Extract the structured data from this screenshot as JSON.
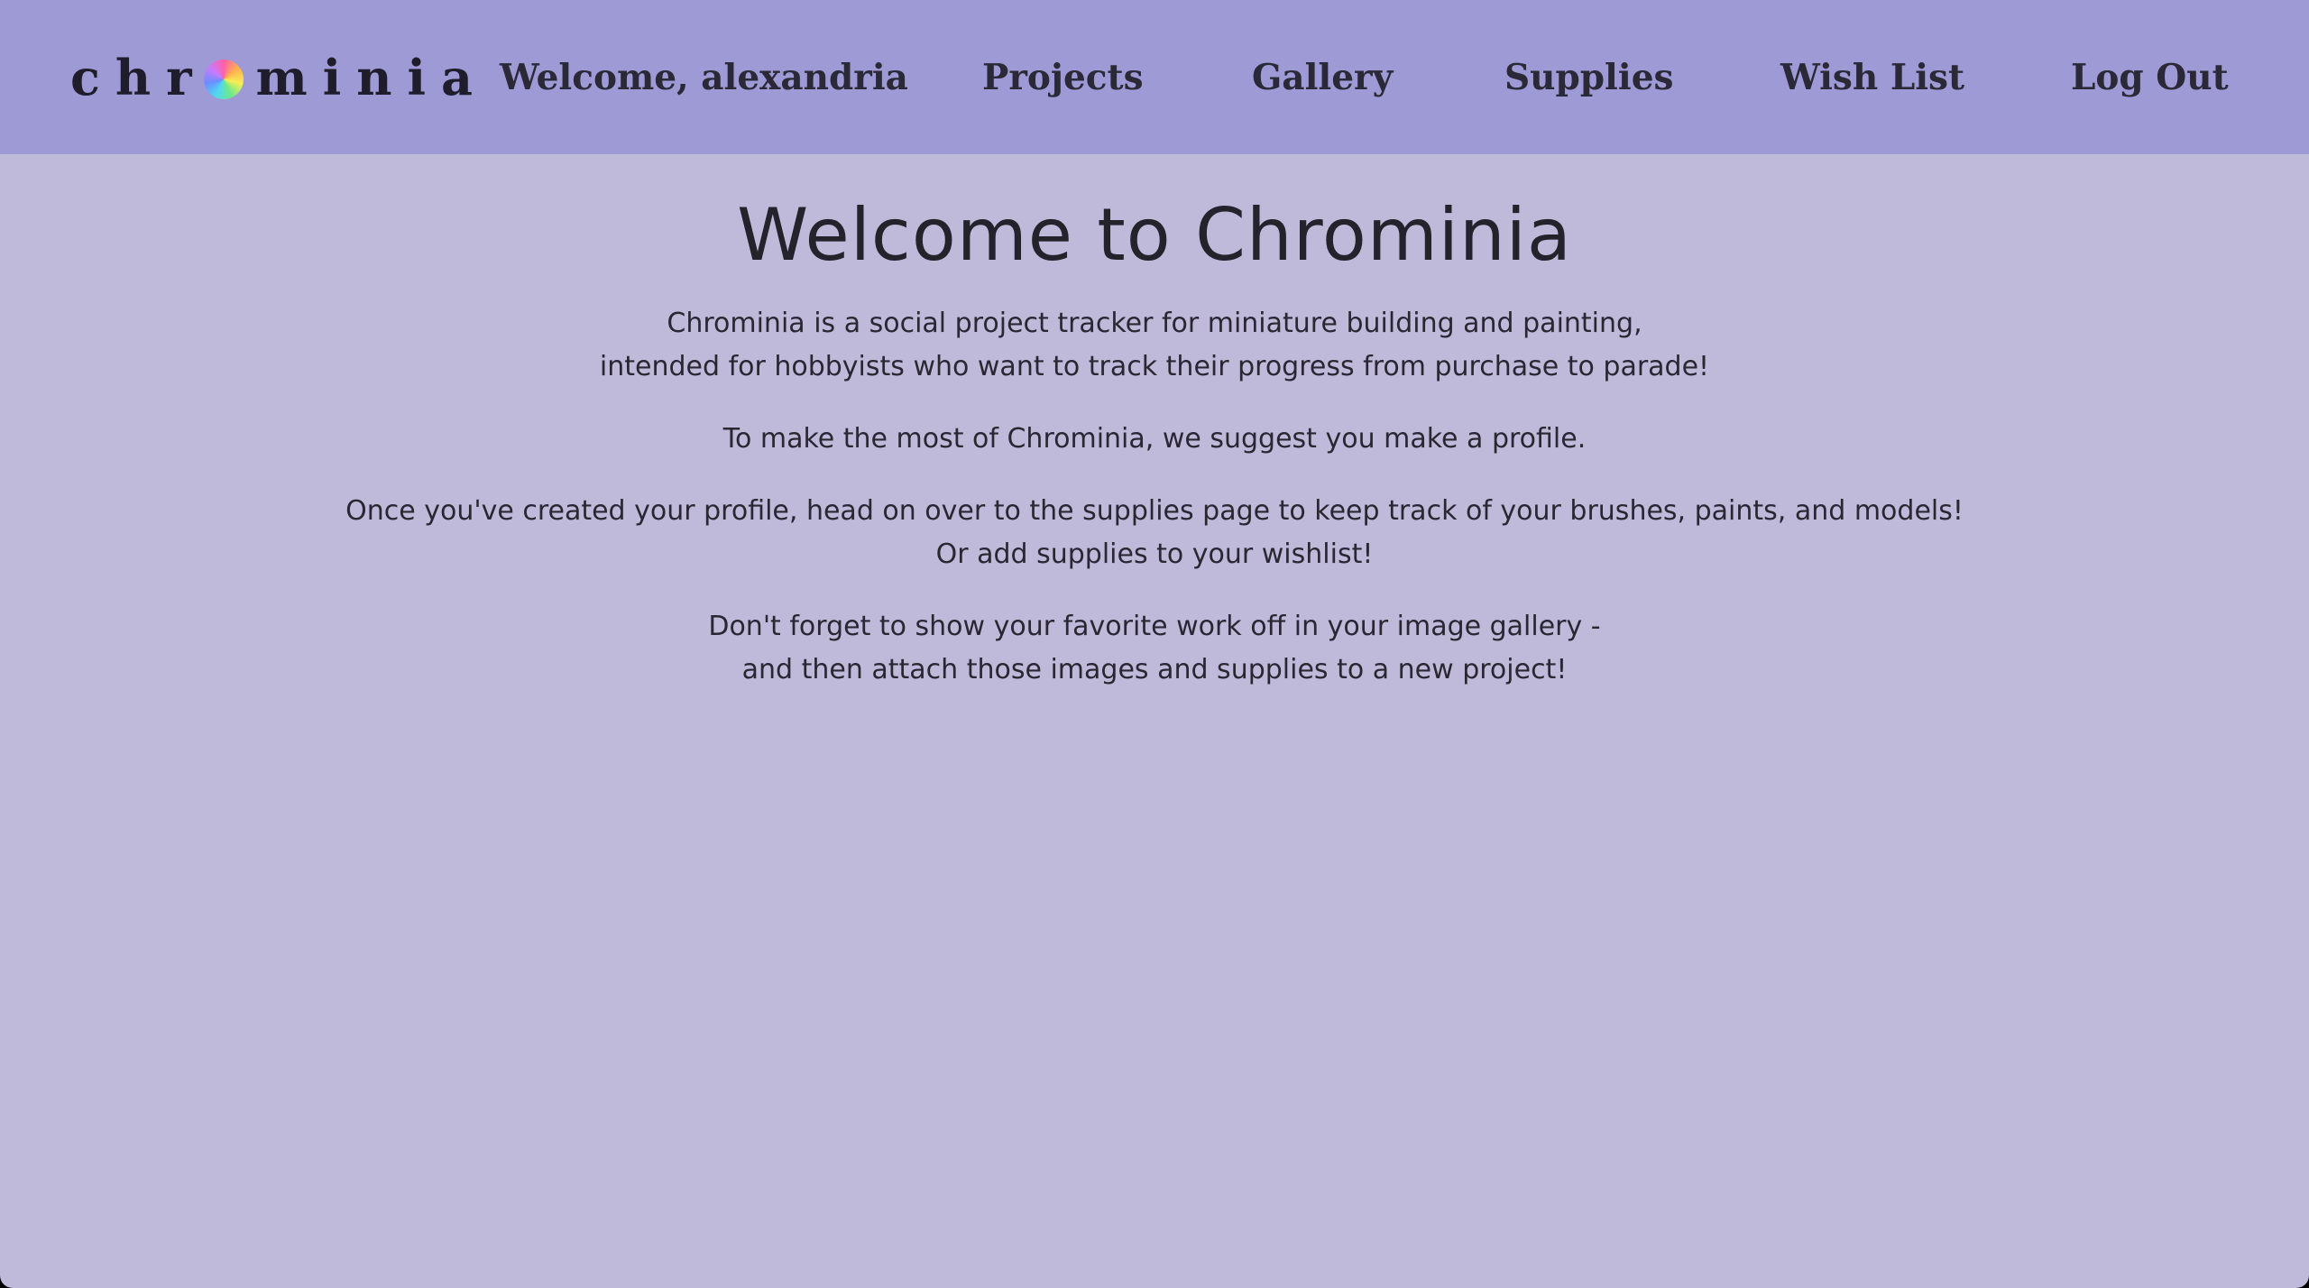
{
  "nav": {
    "logo_prefix": "chr",
    "logo_suffix": "minia",
    "welcome": "Welcome, alexandria",
    "projects": "Projects",
    "gallery": "Gallery",
    "supplies": "Supplies",
    "wishlist": "Wish List",
    "logout": "Log Out"
  },
  "main": {
    "title": "Welcome to Chrominia",
    "paragraphs": [
      {
        "line1": "Chrominia is a social project tracker for miniature building and painting,",
        "line2": "intended for hobbyists who want to track their progress from purchase to parade!"
      },
      {
        "line1": "To make the most of Chrominia, we suggest you make a profile."
      },
      {
        "line1": "Once you've created your profile, head on over to the supplies page to keep track of your brushes, paints, and models!",
        "line2": "Or add supplies to your wishlist!"
      },
      {
        "line1": "Don't forget to show your favorite work off in your image gallery -",
        "line2": "and then attach those images and supplies to a new project!"
      }
    ]
  },
  "icons": {
    "logo_mark": "color-wheel-icon"
  },
  "colors": {
    "navbar_bg": "#9e9ad5",
    "page_bg": "#bfbada",
    "text": "#2a2733"
  }
}
